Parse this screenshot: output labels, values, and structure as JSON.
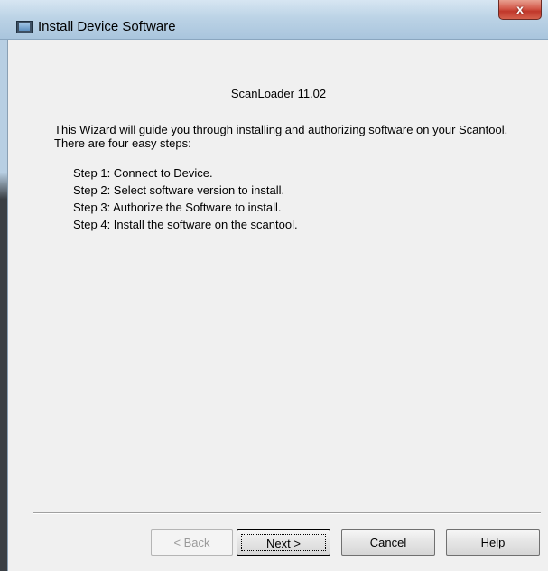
{
  "window": {
    "title": "Install Device Software",
    "close_label": "x"
  },
  "content": {
    "heading": "ScanLoader 11.02",
    "intro": "This Wizard will guide you through installing and authorizing software on your Scantool.  There are four easy steps:",
    "steps": [
      "Step 1:  Connect to Device.",
      "Step 2:  Select software version to install.",
      "Step 3:  Authorize the Software to install.",
      "Step 4:  Install the software on the scantool."
    ]
  },
  "buttons": {
    "back": "< Back",
    "next": "Next >",
    "cancel": "Cancel",
    "help": "Help"
  }
}
